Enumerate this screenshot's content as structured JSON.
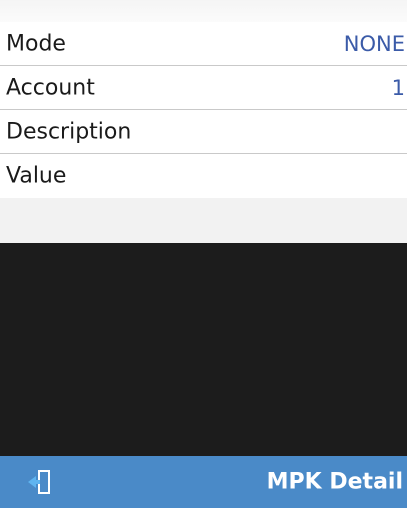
{
  "rows": [
    {
      "label": "Mode",
      "value": "NONE"
    },
    {
      "label": "Account",
      "value": "1"
    },
    {
      "label": "Description",
      "value": ""
    },
    {
      "label": "Value",
      "value": ""
    }
  ],
  "bottom_bar": {
    "title": "MPK Detail",
    "back_icon": "back-arrow-icon"
  },
  "colors": {
    "value_text": "#3b5ba8",
    "bottom_bar_bg": "#4a8ac8",
    "black_area": "#1c1c1c"
  }
}
